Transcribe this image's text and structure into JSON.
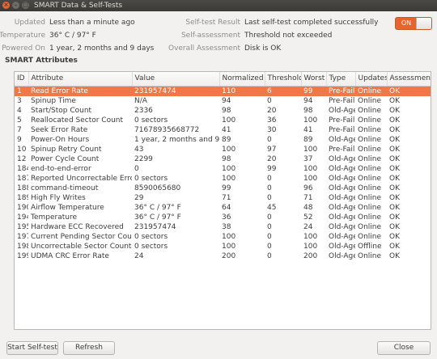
{
  "window": {
    "title": "SMART Data & Self-Tests"
  },
  "info": {
    "updated_label": "Updated",
    "updated_value": "Less than a minute ago",
    "temperature_label": "Temperature",
    "temperature_value": "36° C / 97° F",
    "powered_label": "Powered On",
    "powered_value": "1 year, 2 months and 9 days",
    "selftest_label": "Self-test Result",
    "selftest_value": "Last self-test completed successfully",
    "assessment_label": "Self-assessment",
    "assessment_value": "Threshold not exceeded",
    "overall_label": "Overall Assessment",
    "overall_value": "Disk is OK"
  },
  "toggle": {
    "label": "ON",
    "state": "on"
  },
  "attributes": {
    "heading": "SMART Attributes",
    "columns": [
      "ID",
      "Attribute",
      "Value",
      "Normalized",
      "Threshold",
      "Worst",
      "Type",
      "Updates",
      "Assessment"
    ],
    "rows": [
      [
        "1",
        "Read Error Rate",
        "231957474",
        "110",
        "6",
        "99",
        "Pre-Fail",
        "Online",
        "OK"
      ],
      [
        "3",
        "Spinup Time",
        "N/A",
        "94",
        "0",
        "94",
        "Pre-Fail",
        "Online",
        "OK"
      ],
      [
        "4",
        "Start/Stop Count",
        "2336",
        "98",
        "20",
        "98",
        "Old-Age",
        "Online",
        "OK"
      ],
      [
        "5",
        "Reallocated Sector Count",
        "0 sectors",
        "100",
        "36",
        "100",
        "Pre-Fail",
        "Online",
        "OK"
      ],
      [
        "7",
        "Seek Error Rate",
        "71678935668772",
        "41",
        "30",
        "41",
        "Pre-Fail",
        "Online",
        "OK"
      ],
      [
        "9",
        "Power-On Hours",
        "1 year, 2 months and 9 days",
        "89",
        "0",
        "89",
        "Old-Age",
        "Online",
        "OK"
      ],
      [
        "10",
        "Spinup Retry Count",
        "43",
        "100",
        "97",
        "100",
        "Pre-Fail",
        "Online",
        "OK"
      ],
      [
        "12",
        "Power Cycle Count",
        "2299",
        "98",
        "20",
        "37",
        "Old-Age",
        "Online",
        "OK"
      ],
      [
        "184",
        "end-to-end-error",
        "0",
        "100",
        "99",
        "100",
        "Old-Age",
        "Online",
        "OK"
      ],
      [
        "187",
        "Reported Uncorrectable Errors",
        "0 sectors",
        "100",
        "0",
        "100",
        "Old-Age",
        "Online",
        "OK"
      ],
      [
        "188",
        "command-timeout",
        "8590065680",
        "99",
        "0",
        "96",
        "Old-Age",
        "Online",
        "OK"
      ],
      [
        "189",
        "High Fly Writes",
        "29",
        "71",
        "0",
        "71",
        "Old-Age",
        "Online",
        "OK"
      ],
      [
        "190",
        "Airflow Temperature",
        "36° C / 97° F",
        "64",
        "45",
        "48",
        "Old-Age",
        "Online",
        "OK"
      ],
      [
        "194",
        "Temperature",
        "36° C / 97° F",
        "36",
        "0",
        "52",
        "Old-Age",
        "Online",
        "OK"
      ],
      [
        "195",
        "Hardware ECC Recovered",
        "231957474",
        "38",
        "0",
        "24",
        "Old-Age",
        "Online",
        "OK"
      ],
      [
        "197",
        "Current Pending Sector Count",
        "0 sectors",
        "100",
        "0",
        "100",
        "Old-Age",
        "Online",
        "OK"
      ],
      [
        "198",
        "Uncorrectable Sector Count",
        "0 sectors",
        "100",
        "0",
        "100",
        "Old-Age",
        "Offline",
        "OK"
      ],
      [
        "199",
        "UDMA CRC Error Rate",
        "24",
        "200",
        "0",
        "200",
        "Old-Age",
        "Online",
        "OK"
      ]
    ]
  },
  "buttons": {
    "start_selftest": "Start Self-test",
    "refresh": "Refresh",
    "close": "Close"
  },
  "colors": {
    "accent": "#f07746",
    "toggle_on": "#e8642c",
    "titlebar": "#3b3a37",
    "close_button": "#e2643a"
  },
  "icons": {
    "window_close": "close-icon",
    "window_minimize": "minimize-icon",
    "window_maximize": "maximize-icon"
  }
}
